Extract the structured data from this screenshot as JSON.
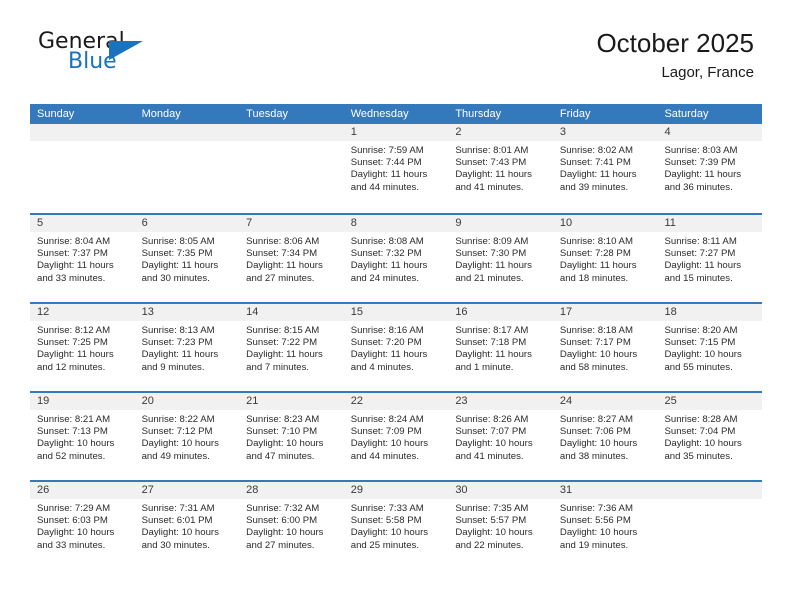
{
  "brand": {
    "name_top": "General",
    "name_bottom": "Blue",
    "accent_color": "#1b72bd"
  },
  "header": {
    "title": "October 2025",
    "subtitle": "Lagor, France"
  },
  "calendar": {
    "header_color": "#3479bb",
    "daynum_bg": "#f1f1f1",
    "day_headers": [
      "Sunday",
      "Monday",
      "Tuesday",
      "Wednesday",
      "Thursday",
      "Friday",
      "Saturday"
    ],
    "weeks": [
      [
        {
          "day": "",
          "sunrise": "",
          "sunset": "",
          "daylight1": "",
          "daylight2": ""
        },
        {
          "day": "",
          "sunrise": "",
          "sunset": "",
          "daylight1": "",
          "daylight2": ""
        },
        {
          "day": "",
          "sunrise": "",
          "sunset": "",
          "daylight1": "",
          "daylight2": ""
        },
        {
          "day": "1",
          "sunrise": "Sunrise: 7:59 AM",
          "sunset": "Sunset: 7:44 PM",
          "daylight1": "Daylight: 11 hours",
          "daylight2": "and 44 minutes."
        },
        {
          "day": "2",
          "sunrise": "Sunrise: 8:01 AM",
          "sunset": "Sunset: 7:43 PM",
          "daylight1": "Daylight: 11 hours",
          "daylight2": "and 41 minutes."
        },
        {
          "day": "3",
          "sunrise": "Sunrise: 8:02 AM",
          "sunset": "Sunset: 7:41 PM",
          "daylight1": "Daylight: 11 hours",
          "daylight2": "and 39 minutes."
        },
        {
          "day": "4",
          "sunrise": "Sunrise: 8:03 AM",
          "sunset": "Sunset: 7:39 PM",
          "daylight1": "Daylight: 11 hours",
          "daylight2": "and 36 minutes."
        }
      ],
      [
        {
          "day": "5",
          "sunrise": "Sunrise: 8:04 AM",
          "sunset": "Sunset: 7:37 PM",
          "daylight1": "Daylight: 11 hours",
          "daylight2": "and 33 minutes."
        },
        {
          "day": "6",
          "sunrise": "Sunrise: 8:05 AM",
          "sunset": "Sunset: 7:35 PM",
          "daylight1": "Daylight: 11 hours",
          "daylight2": "and 30 minutes."
        },
        {
          "day": "7",
          "sunrise": "Sunrise: 8:06 AM",
          "sunset": "Sunset: 7:34 PM",
          "daylight1": "Daylight: 11 hours",
          "daylight2": "and 27 minutes."
        },
        {
          "day": "8",
          "sunrise": "Sunrise: 8:08 AM",
          "sunset": "Sunset: 7:32 PM",
          "daylight1": "Daylight: 11 hours",
          "daylight2": "and 24 minutes."
        },
        {
          "day": "9",
          "sunrise": "Sunrise: 8:09 AM",
          "sunset": "Sunset: 7:30 PM",
          "daylight1": "Daylight: 11 hours",
          "daylight2": "and 21 minutes."
        },
        {
          "day": "10",
          "sunrise": "Sunrise: 8:10 AM",
          "sunset": "Sunset: 7:28 PM",
          "daylight1": "Daylight: 11 hours",
          "daylight2": "and 18 minutes."
        },
        {
          "day": "11",
          "sunrise": "Sunrise: 8:11 AM",
          "sunset": "Sunset: 7:27 PM",
          "daylight1": "Daylight: 11 hours",
          "daylight2": "and 15 minutes."
        }
      ],
      [
        {
          "day": "12",
          "sunrise": "Sunrise: 8:12 AM",
          "sunset": "Sunset: 7:25 PM",
          "daylight1": "Daylight: 11 hours",
          "daylight2": "and 12 minutes."
        },
        {
          "day": "13",
          "sunrise": "Sunrise: 8:13 AM",
          "sunset": "Sunset: 7:23 PM",
          "daylight1": "Daylight: 11 hours",
          "daylight2": "and 9 minutes."
        },
        {
          "day": "14",
          "sunrise": "Sunrise: 8:15 AM",
          "sunset": "Sunset: 7:22 PM",
          "daylight1": "Daylight: 11 hours",
          "daylight2": "and 7 minutes."
        },
        {
          "day": "15",
          "sunrise": "Sunrise: 8:16 AM",
          "sunset": "Sunset: 7:20 PM",
          "daylight1": "Daylight: 11 hours",
          "daylight2": "and 4 minutes."
        },
        {
          "day": "16",
          "sunrise": "Sunrise: 8:17 AM",
          "sunset": "Sunset: 7:18 PM",
          "daylight1": "Daylight: 11 hours",
          "daylight2": "and 1 minute."
        },
        {
          "day": "17",
          "sunrise": "Sunrise: 8:18 AM",
          "sunset": "Sunset: 7:17 PM",
          "daylight1": "Daylight: 10 hours",
          "daylight2": "and 58 minutes."
        },
        {
          "day": "18",
          "sunrise": "Sunrise: 8:20 AM",
          "sunset": "Sunset: 7:15 PM",
          "daylight1": "Daylight: 10 hours",
          "daylight2": "and 55 minutes."
        }
      ],
      [
        {
          "day": "19",
          "sunrise": "Sunrise: 8:21 AM",
          "sunset": "Sunset: 7:13 PM",
          "daylight1": "Daylight: 10 hours",
          "daylight2": "and 52 minutes."
        },
        {
          "day": "20",
          "sunrise": "Sunrise: 8:22 AM",
          "sunset": "Sunset: 7:12 PM",
          "daylight1": "Daylight: 10 hours",
          "daylight2": "and 49 minutes."
        },
        {
          "day": "21",
          "sunrise": "Sunrise: 8:23 AM",
          "sunset": "Sunset: 7:10 PM",
          "daylight1": "Daylight: 10 hours",
          "daylight2": "and 47 minutes."
        },
        {
          "day": "22",
          "sunrise": "Sunrise: 8:24 AM",
          "sunset": "Sunset: 7:09 PM",
          "daylight1": "Daylight: 10 hours",
          "daylight2": "and 44 minutes."
        },
        {
          "day": "23",
          "sunrise": "Sunrise: 8:26 AM",
          "sunset": "Sunset: 7:07 PM",
          "daylight1": "Daylight: 10 hours",
          "daylight2": "and 41 minutes."
        },
        {
          "day": "24",
          "sunrise": "Sunrise: 8:27 AM",
          "sunset": "Sunset: 7:06 PM",
          "daylight1": "Daylight: 10 hours",
          "daylight2": "and 38 minutes."
        },
        {
          "day": "25",
          "sunrise": "Sunrise: 8:28 AM",
          "sunset": "Sunset: 7:04 PM",
          "daylight1": "Daylight: 10 hours",
          "daylight2": "and 35 minutes."
        }
      ],
      [
        {
          "day": "26",
          "sunrise": "Sunrise: 7:29 AM",
          "sunset": "Sunset: 6:03 PM",
          "daylight1": "Daylight: 10 hours",
          "daylight2": "and 33 minutes."
        },
        {
          "day": "27",
          "sunrise": "Sunrise: 7:31 AM",
          "sunset": "Sunset: 6:01 PM",
          "daylight1": "Daylight: 10 hours",
          "daylight2": "and 30 minutes."
        },
        {
          "day": "28",
          "sunrise": "Sunrise: 7:32 AM",
          "sunset": "Sunset: 6:00 PM",
          "daylight1": "Daylight: 10 hours",
          "daylight2": "and 27 minutes."
        },
        {
          "day": "29",
          "sunrise": "Sunrise: 7:33 AM",
          "sunset": "Sunset: 5:58 PM",
          "daylight1": "Daylight: 10 hours",
          "daylight2": "and 25 minutes."
        },
        {
          "day": "30",
          "sunrise": "Sunrise: 7:35 AM",
          "sunset": "Sunset: 5:57 PM",
          "daylight1": "Daylight: 10 hours",
          "daylight2": "and 22 minutes."
        },
        {
          "day": "31",
          "sunrise": "Sunrise: 7:36 AM",
          "sunset": "Sunset: 5:56 PM",
          "daylight1": "Daylight: 10 hours",
          "daylight2": "and 19 minutes."
        },
        {
          "day": "",
          "sunrise": "",
          "sunset": "",
          "daylight1": "",
          "daylight2": ""
        }
      ]
    ]
  }
}
